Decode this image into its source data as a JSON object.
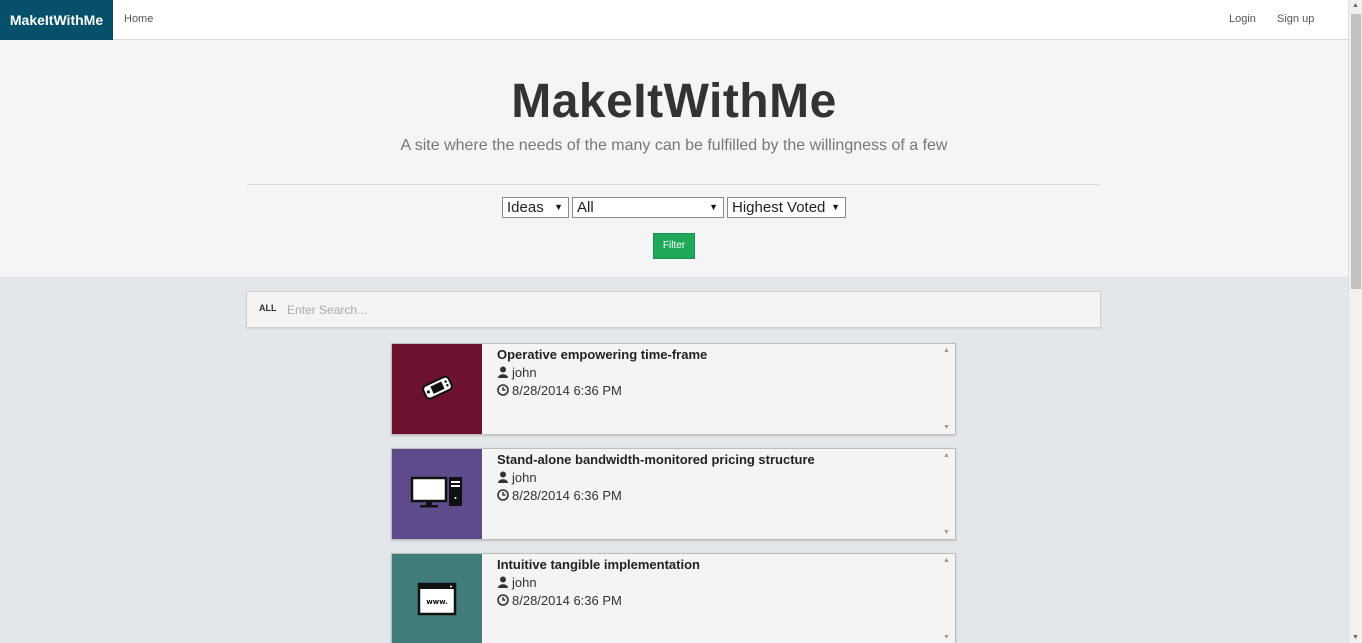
{
  "nav": {
    "brand": "MakeItWithMe",
    "home": "Home",
    "login": "Login",
    "signup": "Sign up"
  },
  "hero": {
    "title": "MakeItWithMe",
    "subtitle": "A site where the needs of the many can be fulfilled by the willingness of a few"
  },
  "filters": {
    "type": "Ideas",
    "category": "All",
    "sort": "Highest Voted",
    "button": "Filter"
  },
  "search": {
    "scope": "ALL",
    "placeholder": "Enter Search..."
  },
  "cards": [
    {
      "title": "Operative empowering time-frame",
      "author": "john",
      "date": "8/28/2014 6:36 PM",
      "color": "#6c1230",
      "icon": "handheld-console-icon"
    },
    {
      "title": "Stand-alone bandwidth-monitored pricing structure",
      "author": "john",
      "date": "8/28/2014 6:36 PM",
      "color": "#5f4b8b",
      "icon": "desktop-computer-icon"
    },
    {
      "title": "Intuitive tangible implementation",
      "author": "john",
      "date": "8/28/2014 6:36 PM",
      "color": "#417c7a",
      "icon": "web-browser-icon"
    }
  ]
}
